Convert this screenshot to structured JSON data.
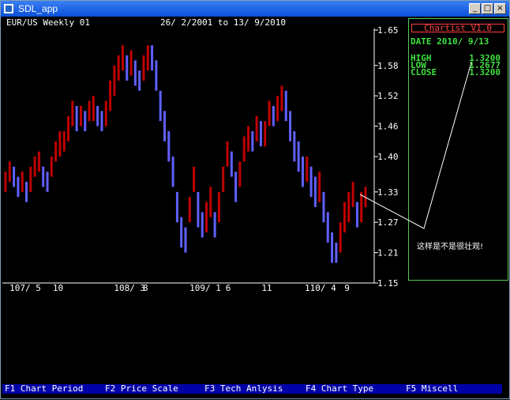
{
  "window": {
    "title": "SDL_app",
    "minimize": "_",
    "maximize": "□",
    "close": "×"
  },
  "header": {
    "symbol": "EUR/US Weekly 01",
    "range": "26/ 2/2001 to 13/ 9/2010"
  },
  "panel": {
    "title": "Chartist V1.0",
    "date": "DATE 2010/ 9/13",
    "high_label": "HIGH",
    "high_value": "1.3200",
    "low_label": "LOW",
    "low_value": "1.2677",
    "close_label": "CLOSE",
    "close_value": "1.3200"
  },
  "annotation": "这样是不是很壮观!",
  "function_keys": {
    "f1": "F1 Chart Period",
    "f2": "F2 Price Scale",
    "f3": "F3 Tech Anlysis",
    "f4": "F4 Chart Type",
    "f5": "F5 Miscell"
  },
  "colors": {
    "up": "#c00000",
    "down": "#6060ff",
    "axis": "#ffffff",
    "panel_border": "#58c858",
    "fbar": "#0000a8"
  },
  "chart_data": {
    "type": "bar",
    "title": "",
    "y_ticks": [
      "1.65",
      "1.58",
      "1.52",
      "1.46",
      "1.40",
      "1.33",
      "1.27",
      "1.21",
      "1.15"
    ],
    "ylim": [
      1.15,
      1.65
    ],
    "x_ticks": [
      "107/ 5",
      "10",
      "108/ 3",
      "8",
      "109/ 1",
      "6",
      "11",
      "110/ 4",
      "9"
    ],
    "x_tick_positions": [
      0.02,
      0.14,
      0.31,
      0.39,
      0.52,
      0.62,
      0.72,
      0.84,
      0.95
    ],
    "series": [
      {
        "values": [
          1.35,
          1.37,
          1.36,
          1.34,
          1.35,
          1.33,
          1.36,
          1.38,
          1.39,
          1.36,
          1.35,
          1.38,
          1.41,
          1.42,
          1.43,
          1.46,
          1.49,
          1.47,
          1.48,
          1.47,
          1.49,
          1.5,
          1.48,
          1.47,
          1.49,
          1.52,
          1.55,
          1.58,
          1.6,
          1.57,
          1.59,
          1.56,
          1.55,
          1.58,
          1.6,
          1.59,
          1.56,
          1.5,
          1.46,
          1.42,
          1.37,
          1.3,
          1.25,
          1.24,
          1.3,
          1.36,
          1.29,
          1.26,
          1.28,
          1.31,
          1.26,
          1.3,
          1.36,
          1.41,
          1.38,
          1.34,
          1.37,
          1.42,
          1.44,
          1.43,
          1.46,
          1.44,
          1.45,
          1.49,
          1.48,
          1.5,
          1.52,
          1.5,
          1.46,
          1.42,
          1.4,
          1.37,
          1.38,
          1.35,
          1.33,
          1.34,
          1.3,
          1.26,
          1.22,
          1.21,
          1.24,
          1.28,
          1.3,
          1.33,
          1.28,
          1.3,
          1.32
        ],
        "highs": [
          1.37,
          1.39,
          1.38,
          1.36,
          1.37,
          1.35,
          1.38,
          1.4,
          1.41,
          1.38,
          1.37,
          1.4,
          1.43,
          1.45,
          1.45,
          1.48,
          1.51,
          1.5,
          1.5,
          1.49,
          1.51,
          1.52,
          1.5,
          1.49,
          1.51,
          1.55,
          1.58,
          1.6,
          1.62,
          1.6,
          1.61,
          1.59,
          1.57,
          1.6,
          1.62,
          1.62,
          1.59,
          1.53,
          1.49,
          1.45,
          1.4,
          1.33,
          1.28,
          1.26,
          1.32,
          1.38,
          1.33,
          1.29,
          1.31,
          1.34,
          1.29,
          1.33,
          1.38,
          1.43,
          1.41,
          1.37,
          1.39,
          1.44,
          1.46,
          1.45,
          1.48,
          1.47,
          1.47,
          1.51,
          1.5,
          1.52,
          1.54,
          1.53,
          1.49,
          1.45,
          1.43,
          1.4,
          1.4,
          1.38,
          1.36,
          1.37,
          1.33,
          1.29,
          1.25,
          1.23,
          1.27,
          1.31,
          1.33,
          1.35,
          1.31,
          1.33,
          1.34
        ],
        "lows": [
          1.33,
          1.35,
          1.34,
          1.32,
          1.33,
          1.31,
          1.33,
          1.36,
          1.37,
          1.34,
          1.33,
          1.36,
          1.39,
          1.4,
          1.41,
          1.43,
          1.46,
          1.45,
          1.46,
          1.45,
          1.47,
          1.47,
          1.46,
          1.45,
          1.46,
          1.49,
          1.52,
          1.55,
          1.57,
          1.55,
          1.56,
          1.54,
          1.53,
          1.55,
          1.57,
          1.57,
          1.53,
          1.47,
          1.43,
          1.39,
          1.34,
          1.27,
          1.22,
          1.21,
          1.27,
          1.33,
          1.26,
          1.24,
          1.25,
          1.28,
          1.24,
          1.27,
          1.33,
          1.38,
          1.36,
          1.31,
          1.34,
          1.39,
          1.41,
          1.41,
          1.43,
          1.42,
          1.42,
          1.46,
          1.46,
          1.47,
          1.49,
          1.47,
          1.43,
          1.39,
          1.37,
          1.34,
          1.35,
          1.32,
          1.3,
          1.31,
          1.27,
          1.23,
          1.19,
          1.19,
          1.21,
          1.25,
          1.27,
          1.3,
          1.26,
          1.27,
          1.3
        ]
      }
    ]
  }
}
